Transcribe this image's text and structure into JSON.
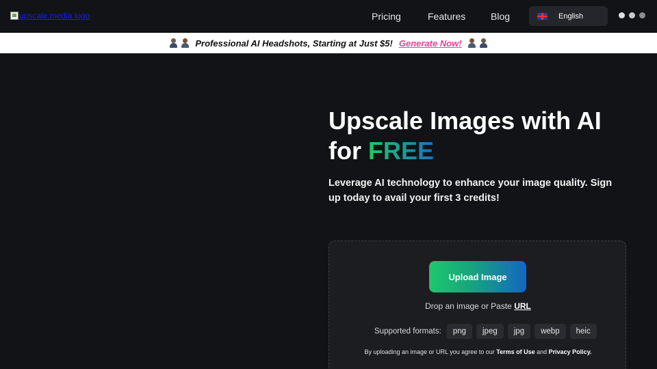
{
  "header": {
    "logo_alt": "upscale.media logo",
    "nav": {
      "pricing": "Pricing",
      "features": "Features",
      "blog": "Blog"
    },
    "language": {
      "label": "English",
      "flag_icon": "uk-flag-icon"
    }
  },
  "promo": {
    "text": "Professional AI Headshots, Starting at Just $5!",
    "link": "Generate Now!",
    "link_color": "#e0459a"
  },
  "hero": {
    "title_line1": "Upscale Images with AI",
    "title_line2_prefix": "for ",
    "title_free": "FREE",
    "subtitle": "Leverage AI technology to enhance your image quality. Sign up today to avail your first 3 credits!"
  },
  "upload": {
    "button_label": "Upload Image",
    "drop_prefix": "Drop an image or Paste ",
    "url_label": "URL",
    "formats_label": "Supported formats:",
    "formats": [
      "png",
      "jpeg",
      "jpg",
      "webp",
      "heic"
    ],
    "terms_prefix": "By uploading an image or URL you agree to our ",
    "terms_link": "Terms of Use",
    "terms_and": " and ",
    "privacy_link": "Privacy Policy."
  },
  "colors": {
    "background": "#111316",
    "gradient_start": "#22c768",
    "gradient_end": "#1466c2"
  }
}
